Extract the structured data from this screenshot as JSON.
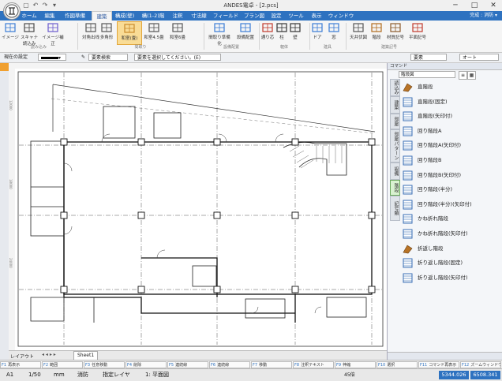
{
  "window": {
    "title": "ANDES電卓 - [2.pcs]",
    "controls": [
      "─",
      "□",
      "✕"
    ]
  },
  "quick_access": [
    "▢",
    "↶",
    "↷",
    "▾"
  ],
  "tabs": [
    {
      "label": "ホーム"
    },
    {
      "label": "編集"
    },
    {
      "label": "作図準備"
    },
    {
      "label": "建築"
    },
    {
      "label": "構成(壁)"
    },
    {
      "label": "構(1-2)階"
    },
    {
      "label": "注釈"
    },
    {
      "label": "寸法線"
    },
    {
      "label": "フィールド"
    },
    {
      "label": "プラン図"
    },
    {
      "label": "設定"
    },
    {
      "label": "ツール"
    },
    {
      "label": "表示"
    },
    {
      "label": "ウィンドウ"
    }
  ],
  "tab_right": "完成 : 消防 ▾",
  "ribbon": {
    "buttons": [
      {
        "label": "イメージ",
        "icon": "image-icon",
        "color": "#3a7bd5"
      },
      {
        "label": "スキャナ読込み",
        "icon": "scanner-icon",
        "color": "#4a4a4a"
      },
      {
        "label": "イメージ補正",
        "icon": "image-adjust-icon",
        "color": "#6a5acd"
      },
      {
        "label": "対角出线",
        "icon": "diagonal-line-icon",
        "color": "#555555"
      },
      {
        "label": "多角形",
        "icon": "polygon-icon",
        "color": "#555555"
      },
      {
        "label": "和室(畳)",
        "icon": "tatami-room-icon",
        "color": "#c98a2b"
      },
      {
        "label": "和室4.5畳",
        "icon": "tatami-4-5-icon",
        "color": "#555555"
      },
      {
        "label": "和室6畳",
        "icon": "tatami-6-icon",
        "color": "#555555"
      },
      {
        "label": "間取り準備化",
        "icon": "layout-icon",
        "color": "#3a7bd5"
      },
      {
        "label": "設備配置",
        "icon": "equipment-icon",
        "color": "#3a7bd5"
      },
      {
        "label": "通り芯",
        "icon": "grid-line-icon",
        "color": "#c0392b"
      },
      {
        "label": "柱",
        "icon": "pillar-icon",
        "color": "#333333"
      },
      {
        "label": "壁",
        "icon": "wall-icon",
        "color": "#333333"
      },
      {
        "label": "ドア",
        "icon": "door-icon",
        "color": "#3a7bd5"
      },
      {
        "label": "窓",
        "icon": "window-icon",
        "color": "#3a7bd5"
      },
      {
        "label": "天井伏図",
        "icon": "ceiling-plan-icon",
        "color": "#555555"
      },
      {
        "label": "階段",
        "icon": "stairs-icon",
        "color": "#b06a1c"
      },
      {
        "label": "材質記号",
        "icon": "material-symbol-icon",
        "color": "#8b5a2b"
      },
      {
        "label": "平面記号",
        "icon": "plan-symbol-icon",
        "color": "#c0392b"
      }
    ],
    "groups": [
      {
        "label": "読み込み"
      },
      {
        "label": "間取り"
      },
      {
        "label": "設備配置"
      },
      {
        "label": "躯体"
      },
      {
        "label": "建具"
      },
      {
        "label": "建築記号"
      }
    ]
  },
  "toolbar2": {
    "current_setting_label": "現在の設定",
    "line_color": "#000000",
    "element_search": "要素検索",
    "select_hint": "要素を選択してください。(E)",
    "right_dropdown_1": "要素",
    "right_dropdown_2": "オート"
  },
  "drawing": {
    "ruler_marks": [
      "12000",
      "18000",
      "24000",
      "30000",
      "36000",
      "42000"
    ]
  },
  "sheet_tabs": {
    "layout_label": "レイアウト",
    "sheet_name": "Sheet1"
  },
  "side_panel": {
    "header": "コマンド",
    "dropdown": "階段図",
    "vertical_tabs": [
      {
        "label": "読込み"
      },
      {
        "label": "建築"
      },
      {
        "label": "部屋"
      },
      {
        "label": "部屋パターン"
      },
      {
        "label": "設備"
      },
      {
        "label": "階段"
      },
      {
        "label": "記号類"
      }
    ],
    "items": [
      {
        "label": "直階段",
        "icon": "stairs-straight-icon"
      },
      {
        "label": "直階段(固定)",
        "icon": "stairs-straight-fixed-icon"
      },
      {
        "label": "直階段(矢印付)",
        "icon": "stairs-straight-arrow-icon"
      },
      {
        "label": "回り階段A",
        "icon": "stairs-turn-a-icon"
      },
      {
        "label": "回り階段A(矢印付)",
        "icon": "stairs-turn-a-arrow-icon"
      },
      {
        "label": "回り階段B",
        "icon": "stairs-turn-b-icon"
      },
      {
        "label": "回り階段B(矢印付)",
        "icon": "stairs-turn-b-arrow-icon"
      },
      {
        "label": "回り階段(半分)",
        "icon": "stairs-half-icon"
      },
      {
        "label": "回り階段(半分)(矢印付)",
        "icon": "stairs-half-arrow-icon"
      },
      {
        "label": "かね折れ階段",
        "icon": "stairs-l-icon"
      },
      {
        "label": "かね折れ階段(矢印付)",
        "icon": "stairs-l-arrow-icon"
      },
      {
        "label": "折返し階段",
        "icon": "stairs-return-icon"
      },
      {
        "label": "折り返し階段(固定)",
        "icon": "stairs-return-fixed-icon"
      },
      {
        "label": "折り返し階段(矢印付)",
        "icon": "stairs-return-arrow-icon"
      }
    ]
  },
  "function_keys": [
    {
      "key": "F1",
      "label": "再表示"
    },
    {
      "key": "F2",
      "label": "範囲"
    },
    {
      "key": "F3",
      "label": "任意移動"
    },
    {
      "key": "F4",
      "label": "削除"
    },
    {
      "key": "F5",
      "label": "連続線"
    },
    {
      "key": "F6",
      "label": "連続線"
    },
    {
      "key": "F7",
      "label": "移動"
    },
    {
      "key": "F8",
      "label": "注釈テキスト"
    },
    {
      "key": "F9",
      "label": "伸縮"
    },
    {
      "key": "F10",
      "label": "選択"
    },
    {
      "key": "F11",
      "label": "コマンド再表示"
    },
    {
      "key": "F12",
      "label": "ズームウィンドウ"
    }
  ],
  "status": {
    "paper": "A1",
    "scale": "1/50",
    "unit": "mm",
    "mode": "消防",
    "layer": "指定レイヤ",
    "view": "1: 平面図",
    "zoom": "45倍",
    "x": "5344.026",
    "y": "6508.341"
  }
}
